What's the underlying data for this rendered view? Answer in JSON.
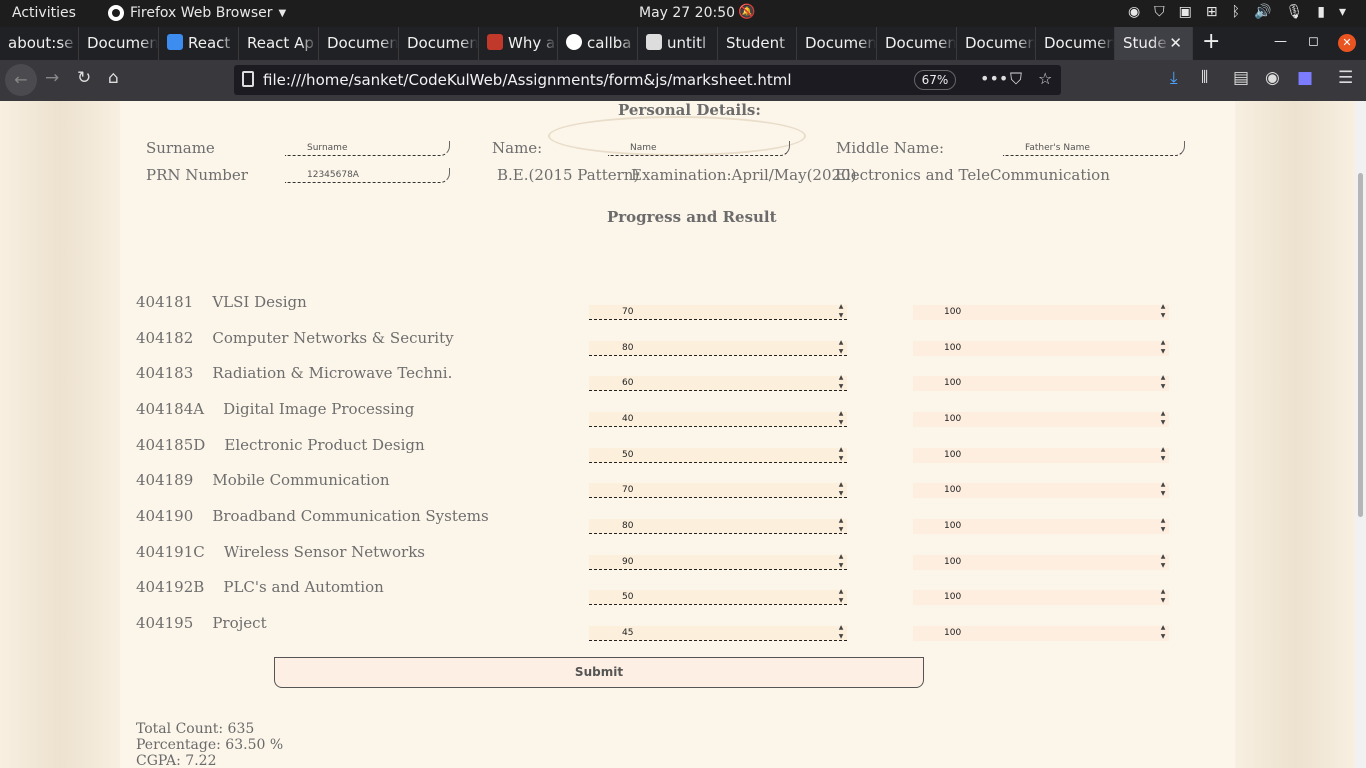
{
  "topbar": {
    "activities": "Activities",
    "app_name": "Firefox Web Browser",
    "clock": "May 27  20:50"
  },
  "tabs": [
    {
      "label": "about:se",
      "favicon": "none"
    },
    {
      "label": "Documen",
      "favicon": "none"
    },
    {
      "label": "React",
      "favicon": "react-icon"
    },
    {
      "label": "React Ap",
      "favicon": "none"
    },
    {
      "label": "Documen",
      "favicon": "none"
    },
    {
      "label": "Documen",
      "favicon": "none"
    },
    {
      "label": "Why a",
      "favicon": "js-icon"
    },
    {
      "label": "callba",
      "favicon": "google-icon"
    },
    {
      "label": "untitl",
      "favicon": "doc-icon"
    },
    {
      "label": "Student",
      "favicon": "none"
    },
    {
      "label": "Documen",
      "favicon": "none"
    },
    {
      "label": "Documen",
      "favicon": "none"
    },
    {
      "label": "Documen",
      "favicon": "none"
    },
    {
      "label": "Documen",
      "favicon": "none"
    },
    {
      "label": "Stude",
      "favicon": "none"
    }
  ],
  "navbar": {
    "url": "file:///home/sanket/CodeKulWeb/Assignments/form&js/marksheet.html",
    "zoom": "67%"
  },
  "page": {
    "personal_heading": "Personal Details:",
    "surname_label": "Surname",
    "surname_placeholder": "Surname",
    "name_label": "Name:",
    "name_placeholder": "Name",
    "middle_label": "Middle Name:",
    "middle_placeholder": "Father's Name",
    "prn_label": "PRN Number",
    "prn_placeholder": "12345678A",
    "pattern": "B.E.(2015 Pattern)",
    "exam": "Examination:April/May(2020)",
    "branch": "Electronics and TeleCommunication",
    "progress_heading": "Progress and Result",
    "subjects": [
      {
        "code": "404181",
        "name": "VLSI Design",
        "marks": "70",
        "max": "100"
      },
      {
        "code": "404182",
        "name": "Computer Networks & Security",
        "marks": "80",
        "max": "100"
      },
      {
        "code": "404183",
        "name": "Radiation & Microwave Techni.",
        "marks": "60",
        "max": "100"
      },
      {
        "code": "404184A",
        "name": "Digital Image Processing",
        "marks": "40",
        "max": "100"
      },
      {
        "code": "404185D",
        "name": "Electronic Product Design",
        "marks": "50",
        "max": "100"
      },
      {
        "code": "404189",
        "name": "Mobile Communication",
        "marks": "70",
        "max": "100"
      },
      {
        "code": "404190",
        "name": "Broadband Communication Systems",
        "marks": "80",
        "max": "100"
      },
      {
        "code": "404191C",
        "name": "Wireless Sensor Networks",
        "marks": "90",
        "max": "100"
      },
      {
        "code": "404192B",
        "name": "PLC's and Automtion",
        "marks": "50",
        "max": "100"
      },
      {
        "code": "404195",
        "name": "Project",
        "marks": "45",
        "max": "100"
      }
    ],
    "submit_label": "Submit",
    "total": "Total Count: 635",
    "percentage": "Percentage: 63.50 %",
    "cgpa": "CGPA: 7.22"
  }
}
